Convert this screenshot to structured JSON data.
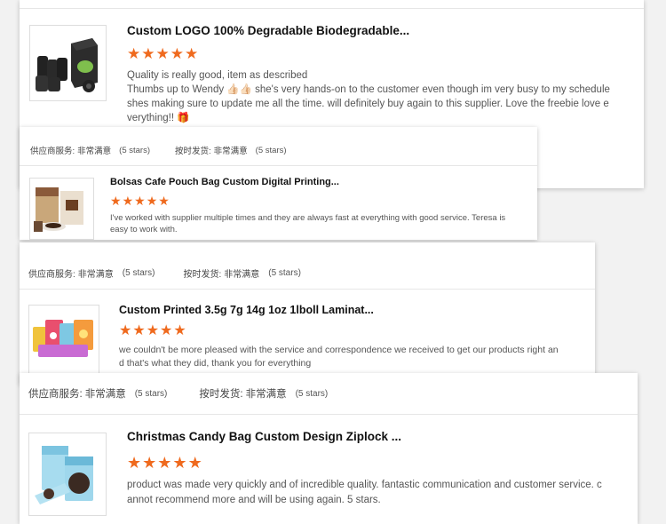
{
  "theme": {
    "star_color": "#ef6a1e"
  },
  "reviews": [
    {
      "title": "Custom LOGO 100% Degradable Biodegradable...",
      "stars": 5,
      "star_glyph": "★",
      "text_line1": "Quality is really good, item as described",
      "text_line2": "Thumbs up to Wendy 👍🏻👍🏻 she's very hands-on to the customer even though im very busy to my schedule",
      "text_line3": "shes making sure to update me all the time. will definitely buy again to this supplier. Love the freebie love e",
      "text_line4": "verything!! 🎁",
      "image_icon": "dog-poop-bag-rolls-icon"
    },
    {
      "supplier_label": "供应商服务:",
      "supplier_value": "非常满意",
      "supplier_stars": "(5 stars)",
      "delivery_label": "按时发货:",
      "delivery_value": "非常满意",
      "delivery_stars": "(5 stars)",
      "title": "Bolsas Cafe Pouch Bag Custom Digital Printing...",
      "stars": 5,
      "star_glyph": "★",
      "text_line1": "I've worked with supplier multiple times and they are always fast at everything with good service. Teresa is",
      "text_line2": "easy to work with.",
      "image_icon": "coffee-pouch-icon"
    },
    {
      "supplier_label": "供应商服务:",
      "supplier_value": "非常满意",
      "supplier_stars": "(5 stars)",
      "delivery_label": "按时发货:",
      "delivery_value": "非常满意",
      "delivery_stars": "(5 stars)",
      "title": "Custom Printed 3.5g 7g 14g 1oz 1lboll Laminat...",
      "stars": 5,
      "star_glyph": "★",
      "text_line1": "we couldn't be more pleased with the service and correspondence we received to get our products right an",
      "text_line2": "d that's what they did, thank you for everything",
      "image_icon": "printed-mylar-bags-icon"
    },
    {
      "supplier_label": "供应商服务:",
      "supplier_value": "非常满意",
      "supplier_stars": "(5 stars)",
      "delivery_label": "按时发货:",
      "delivery_value": "非常满意",
      "delivery_stars": "(5 stars)",
      "title": "Christmas Candy Bag Custom Design Ziplock ...",
      "stars": 5,
      "star_glyph": "★",
      "text_line1": "product was made very quickly and of incredible quality. fantastic communication and customer service. c",
      "text_line2": "annot recommend more and will be using again. 5 stars.",
      "image_icon": "ziplock-candy-bag-icon"
    }
  ]
}
